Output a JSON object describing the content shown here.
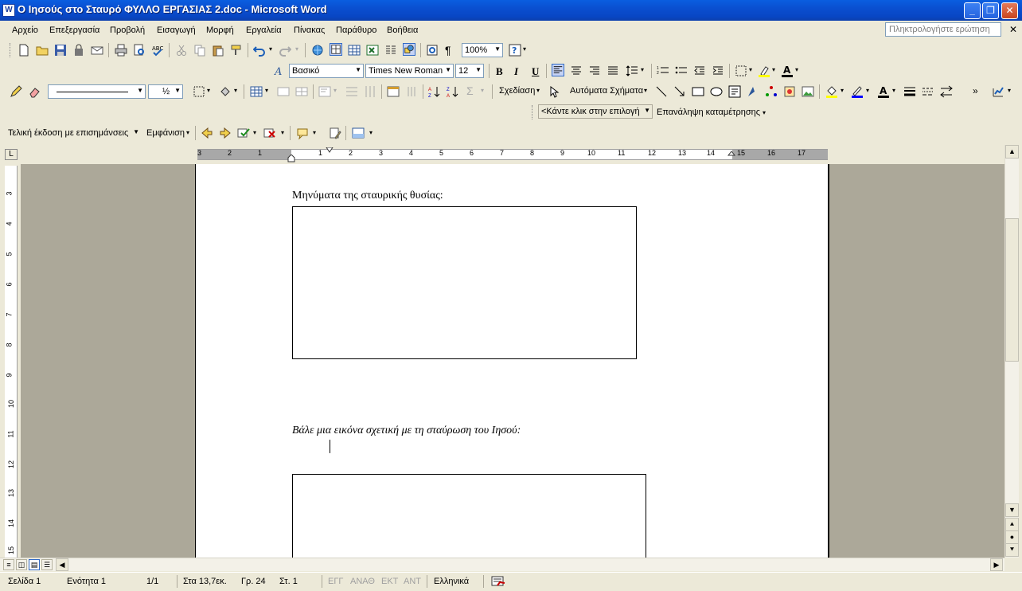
{
  "window": {
    "title": "Ο Ιησούς στο Σταυρό ΦΥΛΛΟ ΕΡΓΑΣΙΑΣ 2.doc - Microsoft Word",
    "app_icon": "W",
    "minimize": "_",
    "restore": "❐",
    "close": "✕"
  },
  "menu": {
    "items": [
      "Αρχείο",
      "Επεξεργασία",
      "Προβολή",
      "Εισαγωγή",
      "Μορφή",
      "Εργαλεία",
      "Πίνακας",
      "Παράθυρο",
      "Βοήθεια"
    ],
    "help_placeholder": "Πληκτρολογήστε ερώτηση",
    "doc_close": "✕"
  },
  "standard_toolbar": {
    "zoom": "100%"
  },
  "formatting_toolbar": {
    "style": "Βασικό",
    "font": "Times New Roman",
    "size": "12",
    "bold": "B",
    "italic": "I",
    "underline": "U"
  },
  "drawing_toolbar": {
    "line_weight": "½",
    "draw_label": "Σχεδίαση",
    "autoshapes_label": "Αυτόματα Σχήματα"
  },
  "numbering_toolbar": {
    "select_label": "<Κάντε κλικ στην επιλογή",
    "restart_label": "Επανάληψη καταμέτρησης"
  },
  "reviewing_toolbar": {
    "display_mode": "Τελική έκδοση με επισημάνσεις",
    "show_label": "Εμφάνιση"
  },
  "ruler": {
    "h_ticks": [
      "3",
      "2",
      "1",
      "1",
      "2",
      "3",
      "4",
      "5",
      "6",
      "7",
      "8",
      "9",
      "10",
      "11",
      "12",
      "13",
      "14",
      "15",
      "16",
      "17"
    ],
    "v_ticks": [
      "3",
      "4",
      "5",
      "6",
      "7",
      "8",
      "9",
      "10",
      "11",
      "12",
      "13",
      "14",
      "15"
    ],
    "corner": "L"
  },
  "document": {
    "heading1": "Μηνύματα της σταυρικής θυσίας:",
    "heading2": "Βάλε μια εικόνα σχετική με τη σταύρωση του Ιησού:"
  },
  "statusbar": {
    "page": "Σελίδα 1",
    "section": "Ενότητα 1",
    "page_of": "1/1",
    "position": "Στα 13,7εκ.",
    "line": "Γρ. 24",
    "column": "Στ. 1",
    "rec": "ΕΓΓ",
    "trk": "ΑΝΑΘ",
    "ext": "ΕΚΤ",
    "ovr": "ΑΝΤ",
    "language": "Ελληνικά"
  },
  "colors": {
    "titlebar": "#0a4fd0",
    "chrome": "#ece9d8",
    "workspace": "#aca899"
  }
}
